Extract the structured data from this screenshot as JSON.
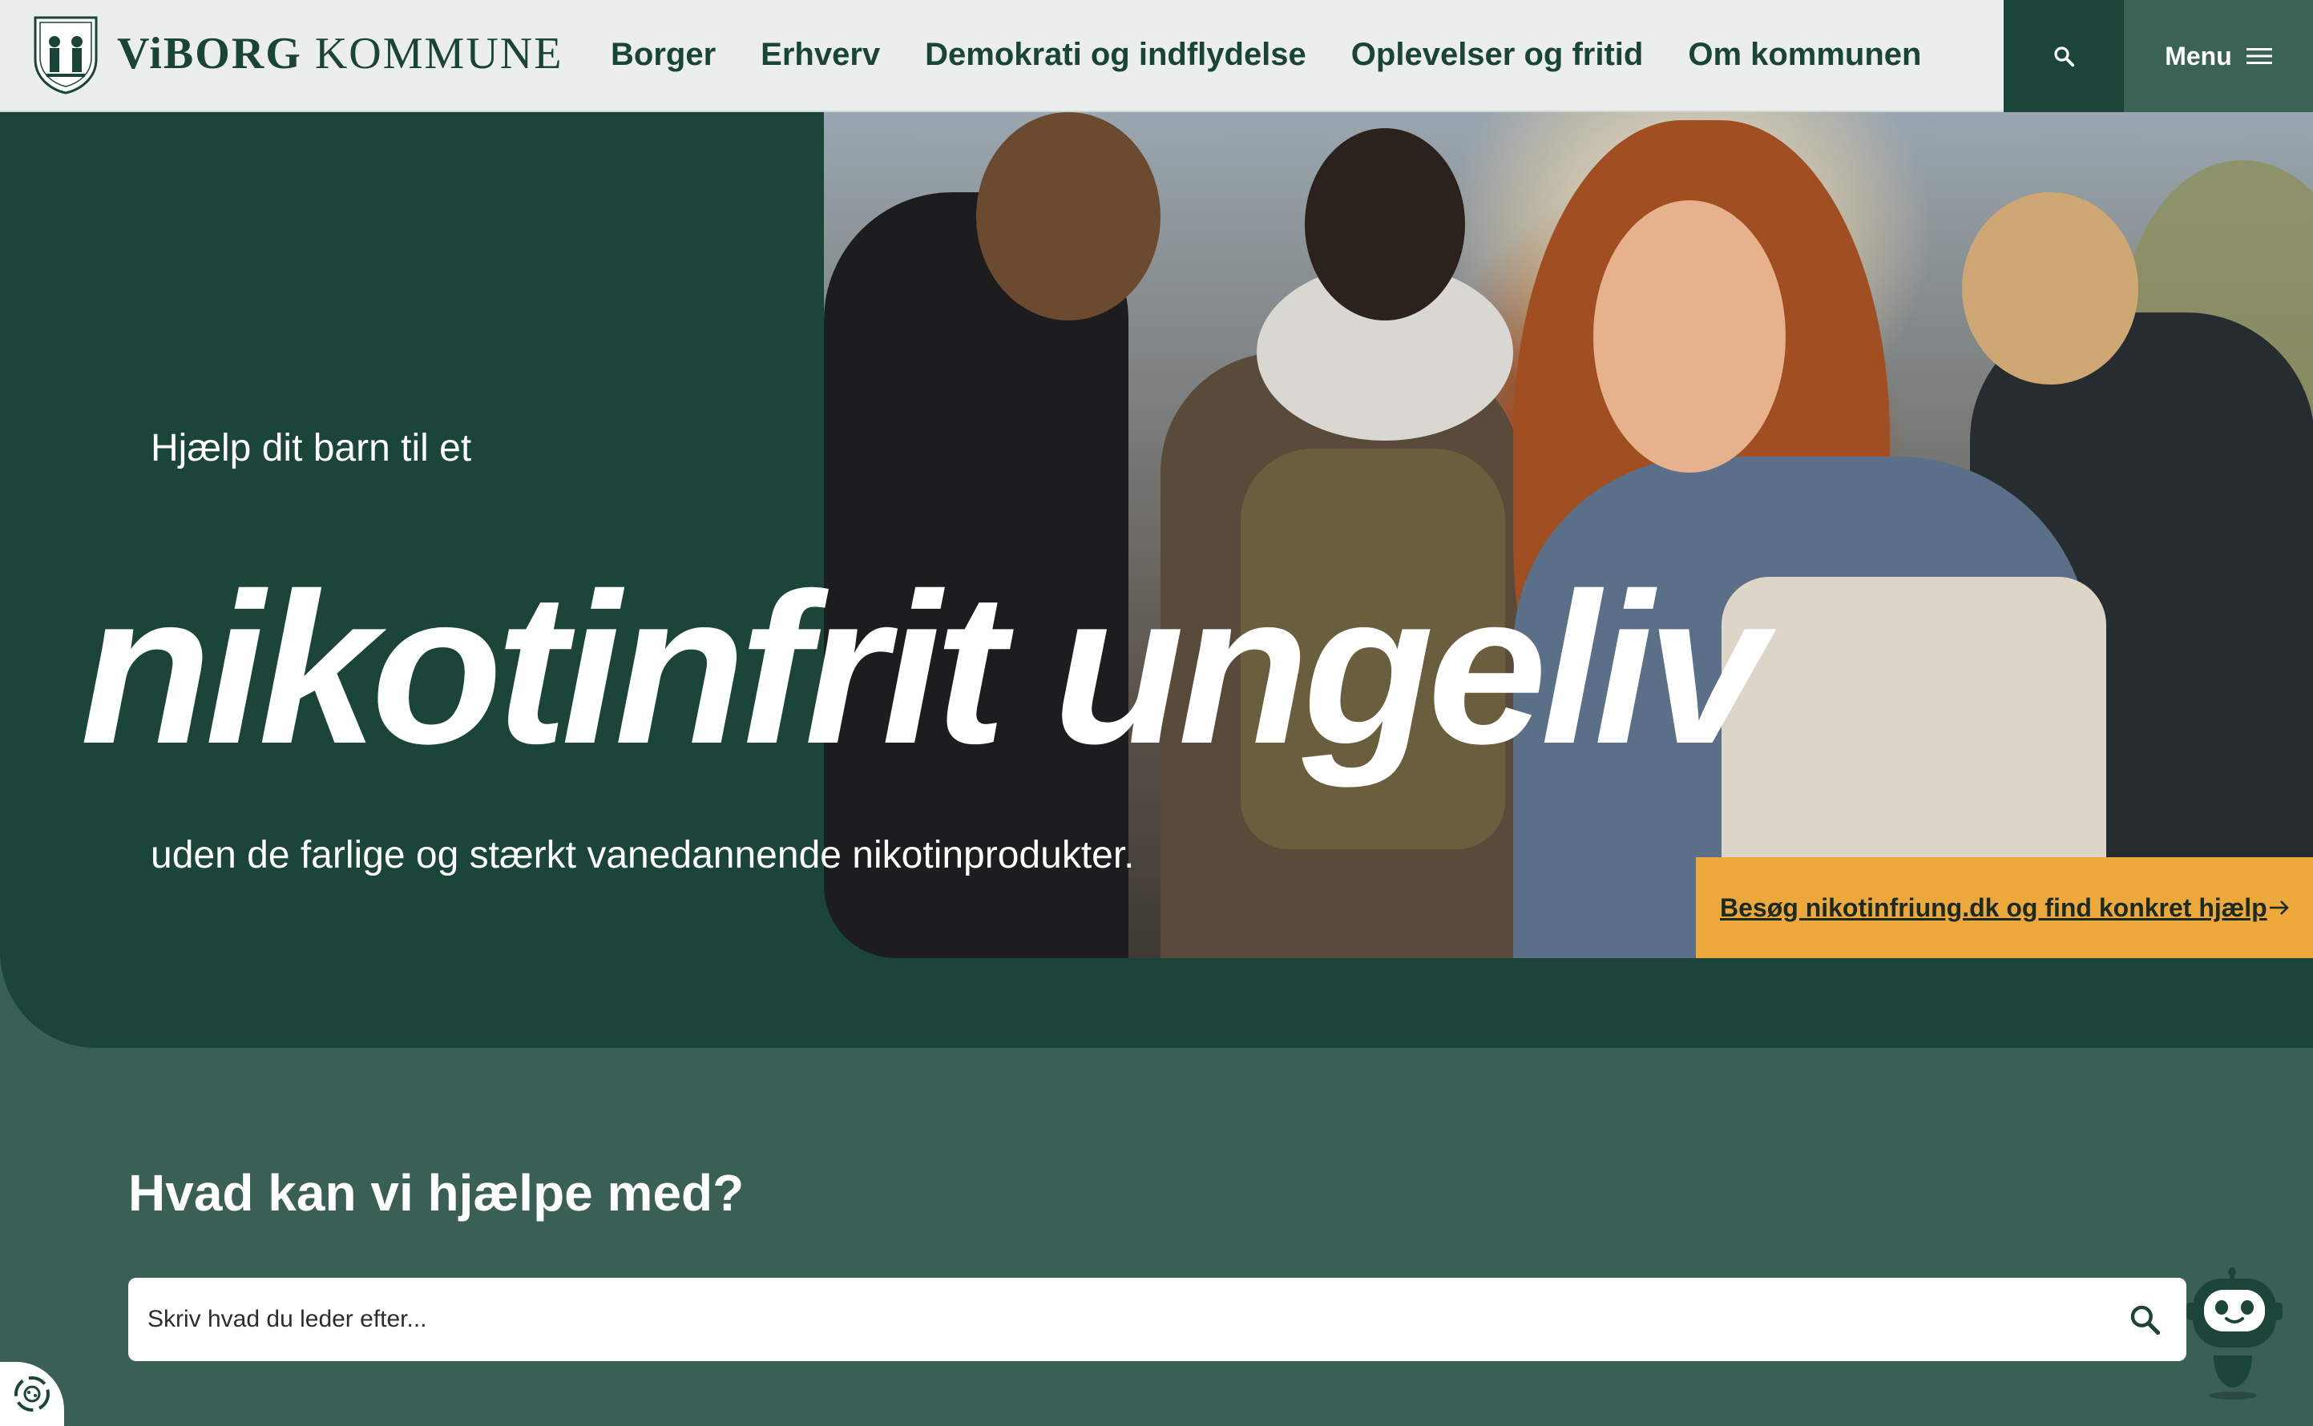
{
  "header": {
    "logo": {
      "brand": "ViBORG",
      "suffix": "KOMMUNE"
    },
    "nav": [
      "Borger",
      "Erhverv",
      "Demokrati og indflydelse",
      "Oplevelser og fritid",
      "Om kommunen"
    ],
    "search_icon": "search-icon",
    "menu_label": "Menu",
    "menu_icon": "hamburger-icon"
  },
  "hero": {
    "eyebrow": "Hjælp dit barn til et",
    "headline": "nikotinfrit ungeliv",
    "subline": "uden de farlige og stærkt vanedannende nikotinprodukter.",
    "cta_label": "Besøg nikotinfriung.dk og find konkret hjælp",
    "cta_icon": "arrow-right-icon"
  },
  "help": {
    "title": "Hvad kan vi hjælpe med?",
    "search_placeholder": "Skriv hvad du leder efter...",
    "search_icon": "search-icon"
  },
  "widgets": {
    "chatbot_icon": "chatbot-icon",
    "cookie_icon": "cookie-settings-icon"
  },
  "colors": {
    "dark_green": "#1c4539",
    "mid_green": "#3a5f55",
    "accent": "#eca83a",
    "header_bg": "#eceeed"
  }
}
